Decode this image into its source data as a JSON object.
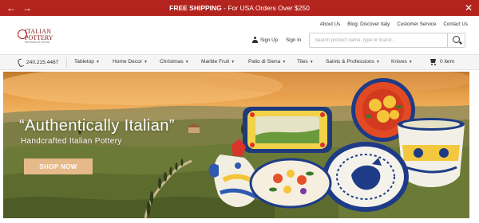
{
  "promo": {
    "bold_text": "FREE SHIPPING",
    "text": " - For USA Orders Over $250",
    "prev_icon": "arrow-left-icon",
    "next_icon": "arrow-right-icon",
    "close_icon": "close-icon"
  },
  "brand": {
    "logo_line1": "ITALIAN",
    "logo_line2": "POTTERY",
    "logo_tagline": "Merchant of Deruta"
  },
  "top_links": [
    "About Us",
    "Blog: Discover Italy",
    "Customer Service",
    "Contact Us"
  ],
  "account": {
    "sign_up": "Sign Up",
    "sign_in": "Sign In"
  },
  "search": {
    "placeholder": "Search product name, type or brand...",
    "value": ""
  },
  "nav": {
    "phone": "240.215.4467",
    "items": [
      "Tabletop",
      "Home Decor",
      "Christmas",
      "Marble Fruit",
      "Palio di Siena",
      "Tiles",
      "Saints & Professions",
      "Knives"
    ],
    "cart_label": "0 item"
  },
  "hero": {
    "title": "“Authentically Italian”",
    "subtitle": "Handcrafted Italian Pottery",
    "cta": "SHOP NOW"
  },
  "colors": {
    "accent": "#b4241e",
    "cta": "#e6b98a"
  }
}
